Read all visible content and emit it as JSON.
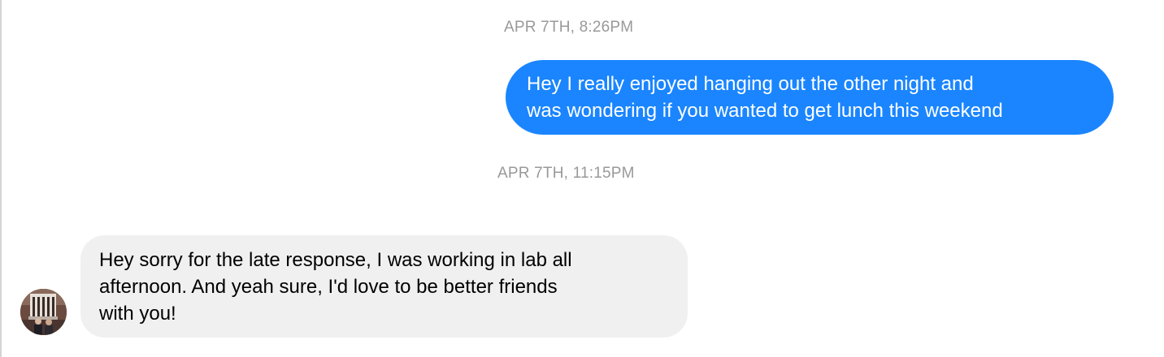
{
  "conversation": {
    "timestamps": [
      "APR 7TH, 8:26PM",
      "APR 7TH, 11:15PM"
    ],
    "messages": [
      {
        "direction": "outgoing",
        "lines": [
          "Hey I really enjoyed hanging out the other night and",
          "was wondering if you wanted to get lunch this weekend"
        ]
      },
      {
        "direction": "incoming",
        "lines": [
          "Hey sorry for the late response, I was working in lab all",
          "afternoon. And yeah sure, I'd love to be better friends",
          "with you!"
        ]
      }
    ]
  },
  "contact": {
    "avatar_icon": "user-avatar-photo"
  },
  "colors": {
    "outgoing_bubble": "#1a85ff",
    "incoming_bubble": "#f0f0f0",
    "timestamp_text": "#999999"
  }
}
